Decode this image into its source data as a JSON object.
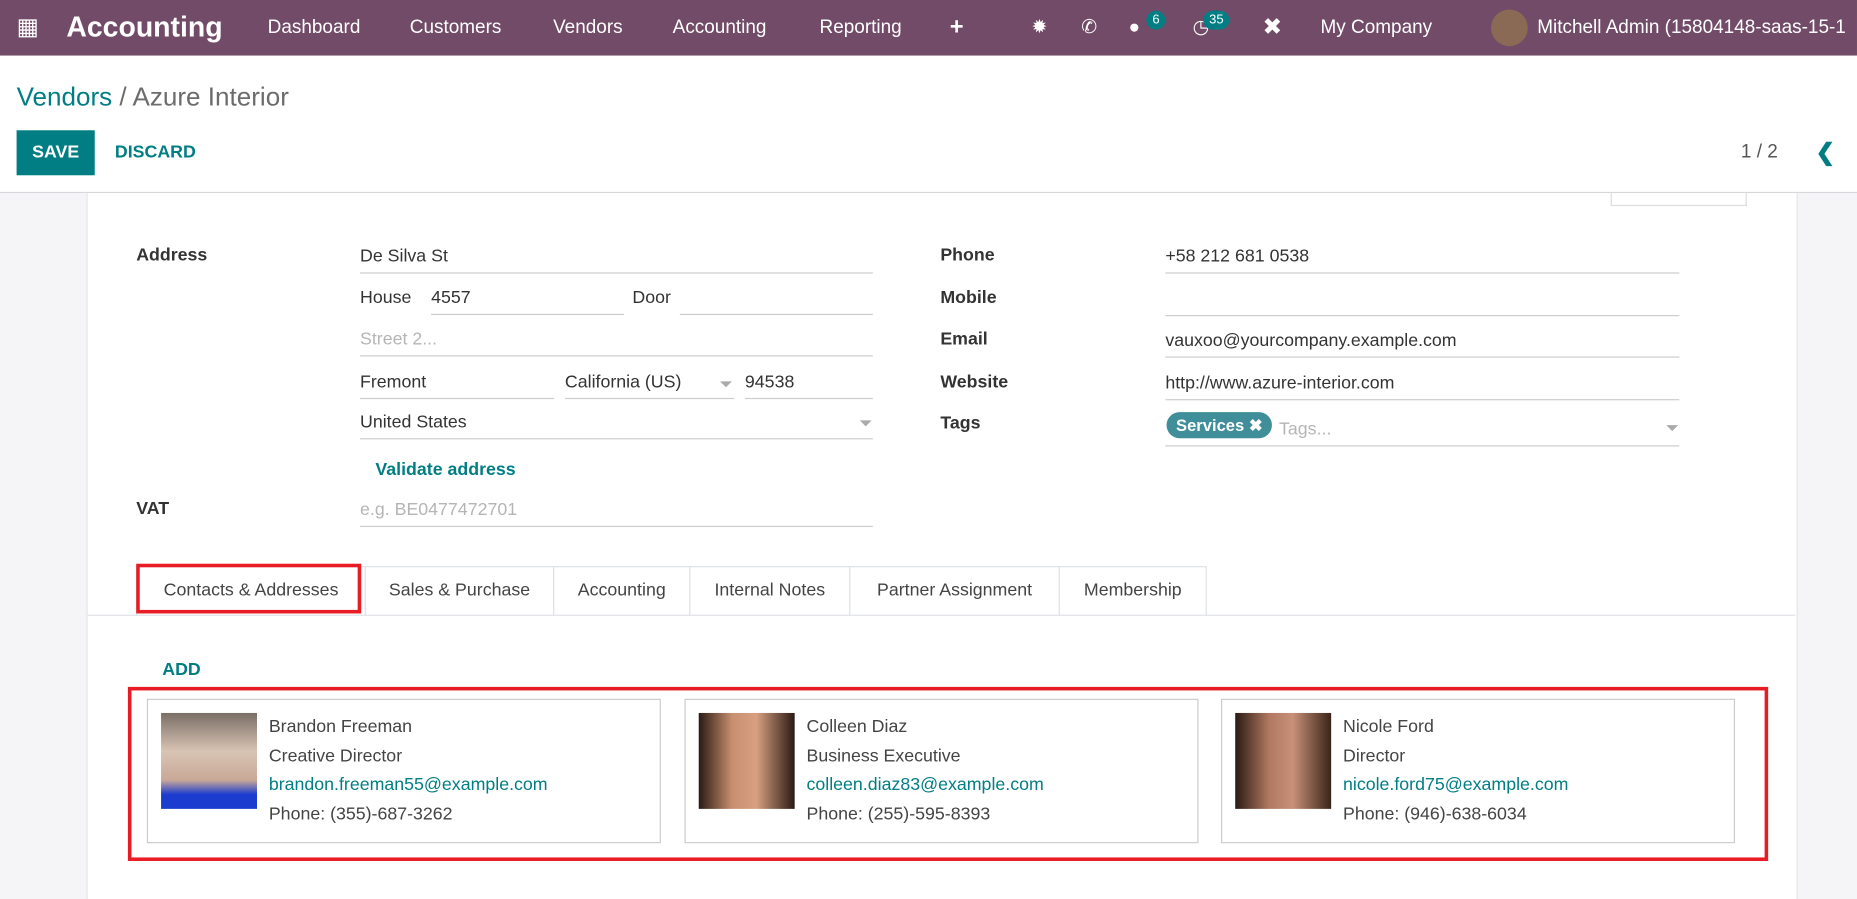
{
  "nav": {
    "app_title": "Accounting",
    "menu": [
      "Dashboard",
      "Customers",
      "Vendors",
      "Accounting",
      "Reporting"
    ],
    "messages_count": "6",
    "activities_count": "35",
    "company": "My Company",
    "user": "Mitchell Admin (15804148-saas-15-1"
  },
  "breadcrumb": {
    "parent": "Vendors",
    "separator": " / ",
    "current": "Azure Interior"
  },
  "toolbar": {
    "save": "SAVE",
    "discard": "DISCARD",
    "pager": "1 / 2"
  },
  "form": {
    "address_label": "Address",
    "street": "De Silva St",
    "house_label": "House",
    "house": "4557",
    "door_label": "Door",
    "door": "",
    "street2_placeholder": "Street 2...",
    "city": "Fremont",
    "state": "California (US)",
    "zip": "94538",
    "country": "United States",
    "validate": "Validate address",
    "vat_label": "VAT",
    "vat_placeholder": "e.g. BE0477472701",
    "phone_label": "Phone",
    "phone": "+58 212 681 0538",
    "mobile_label": "Mobile",
    "mobile": "",
    "email_label": "Email",
    "email": "vauxoo@yourcompany.example.com",
    "website_label": "Website",
    "website": "http://www.azure-interior.com",
    "tags_label": "Tags",
    "tag": "Services",
    "tags_placeholder": "Tags..."
  },
  "tabs": [
    "Contacts & Addresses",
    "Sales & Purchase",
    "Accounting",
    "Internal Notes",
    "Partner Assignment",
    "Membership"
  ],
  "contacts": {
    "add": "ADD",
    "items": [
      {
        "name": "Brandon Freeman",
        "title": "Creative Director",
        "email": "brandon.freeman55@example.com",
        "phone": "Phone: (355)-687-3262"
      },
      {
        "name": "Colleen Diaz",
        "title": "Business Executive",
        "email": "colleen.diaz83@example.com",
        "phone": "Phone: (255)-595-8393"
      },
      {
        "name": "Nicole Ford",
        "title": "Director",
        "email": "nicole.ford75@example.com",
        "phone": "Phone: (946)-638-6034"
      }
    ]
  },
  "colors": {
    "brand": "#714b67",
    "accent": "#017e84",
    "highlight": "#e71c24"
  }
}
